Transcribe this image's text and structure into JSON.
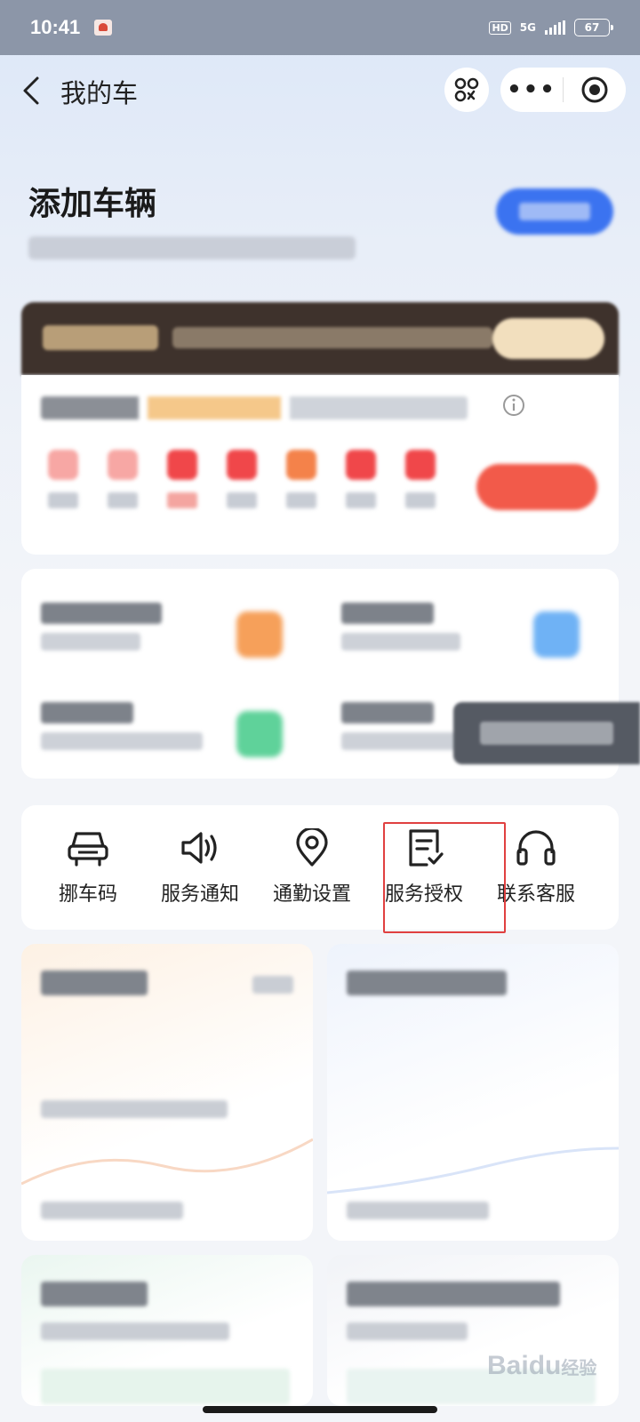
{
  "status_bar": {
    "time": "10:41",
    "hd": "HD",
    "network": "5G",
    "battery": "67"
  },
  "nav": {
    "title": "我的车",
    "more_label": "•••"
  },
  "add_vehicle": {
    "title": "添加车辆"
  },
  "quick_actions": [
    {
      "label": "挪车码",
      "icon": "car-icon"
    },
    {
      "label": "服务通知",
      "icon": "speaker-icon"
    },
    {
      "label": "通勤设置",
      "icon": "location-pin-icon"
    },
    {
      "label": "服务授权",
      "icon": "document-check-icon"
    },
    {
      "label": "联系客服",
      "icon": "headset-icon"
    }
  ],
  "watermark": {
    "brand": "Bai",
    "brand_tail": "du",
    "suffix": "经验"
  },
  "colors": {
    "accent_blue": "#3b73f0",
    "accent_red": "#f25a4a",
    "highlight_box": "#e04040"
  }
}
